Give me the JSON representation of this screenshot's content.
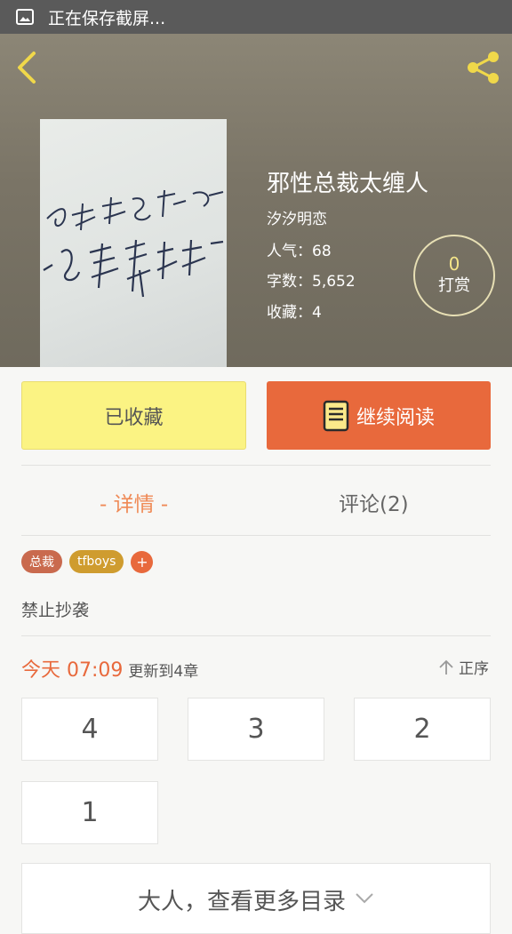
{
  "status_bar": {
    "text": "正在保存截屏..."
  },
  "book": {
    "title": "邪性总裁太缠人",
    "author": "汐汐明恋",
    "popularity": "人气：68",
    "words": "字数：5,652",
    "favorites": "收藏：4"
  },
  "reward": {
    "count": "0",
    "label": "打赏"
  },
  "actions": {
    "favorited_label": "已收藏",
    "continue_label": "继续阅读"
  },
  "tabs": {
    "details": "- 详情 -",
    "comments": "评论(2)"
  },
  "tags": [
    "总裁",
    "tfboys"
  ],
  "tag_add": "+",
  "description": "禁止抄袭",
  "update": {
    "time": "今天 07:09",
    "text": "更新到4章"
  },
  "sort": {
    "label": "正序"
  },
  "chapters": [
    "4",
    "3",
    "2",
    "1"
  ],
  "more": {
    "label": "大人，查看更多目录"
  },
  "colors": {
    "accent": "#e8693c",
    "favorite_bg": "#fbf383",
    "tab_active": "#ef8a56"
  }
}
